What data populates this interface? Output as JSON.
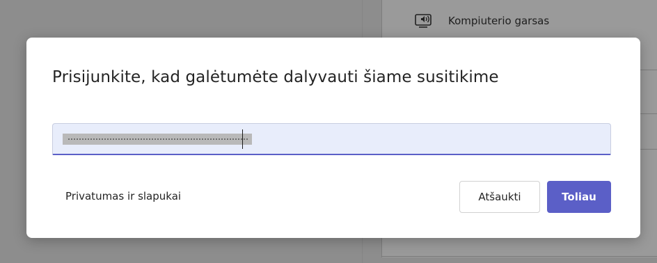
{
  "background": {
    "audio_option_label": "Kompiuterio garsas",
    "audio_option_icon": "computer-audio-icon"
  },
  "dialog": {
    "title": "Prisijunkite, kad galėtumėte dalyvauti šiame susitikime",
    "name_input": {
      "value": "",
      "value_redacted": true
    },
    "privacy_link": "Privatumas ir slapukai",
    "cancel_label": "Atšaukti",
    "next_label": "Toliau"
  },
  "colors": {
    "accent": "#5b5fc7",
    "input_background": "#e8edfb",
    "overlay": "#8d8d8d",
    "dialog_background": "#ffffff",
    "text": "#242424"
  }
}
